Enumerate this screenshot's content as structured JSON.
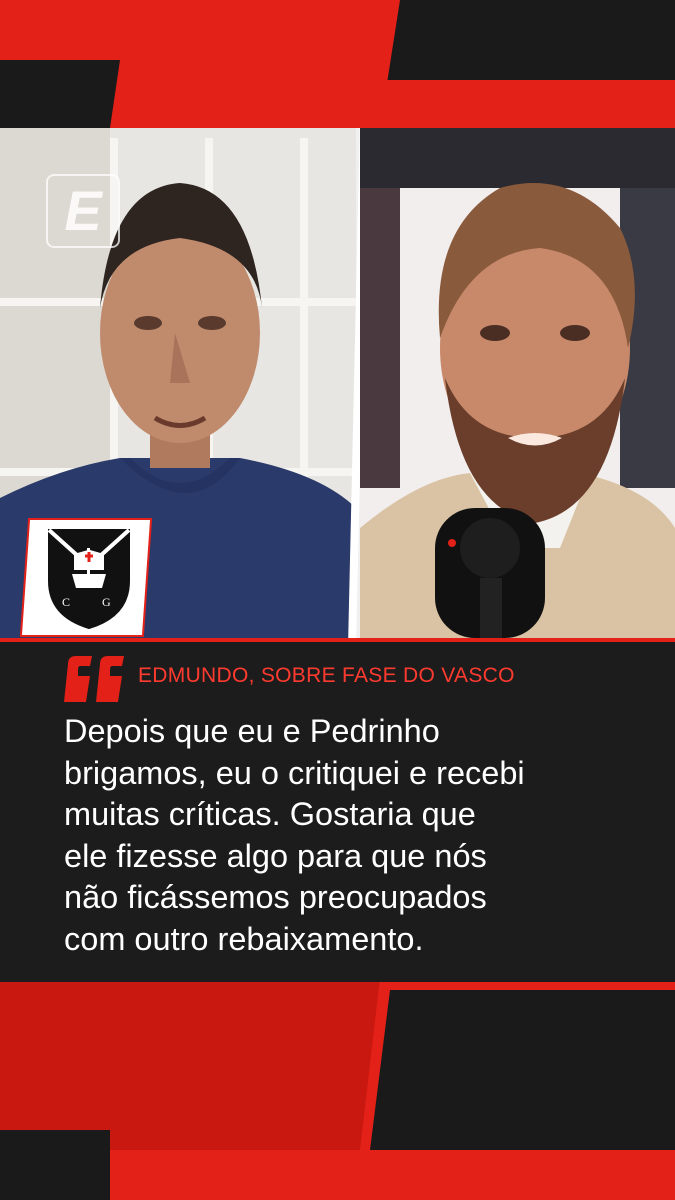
{
  "brand": {
    "logo_text": "E",
    "accent_color": "#e32118",
    "dark_color": "#1c1c1c"
  },
  "images": {
    "left_person": "Edmundo speaking in front of white shelves, navy t-shirt",
    "right_person": "Pedrinho, bearded man in beige jacket speaking at microphone",
    "crest": "Vasco da Gama crest"
  },
  "quote": {
    "attribution": "EDMUNDO, SOBRE FASE DO VASCO",
    "lines": [
      "Depois que eu e Pedrinho",
      "brigamos, eu o critiquei e recebi",
      "muitas críticas. Gostaria que",
      "ele fizesse algo para que nós",
      "não ficássemos preocupados",
      "com outro rebaixamento."
    ]
  }
}
